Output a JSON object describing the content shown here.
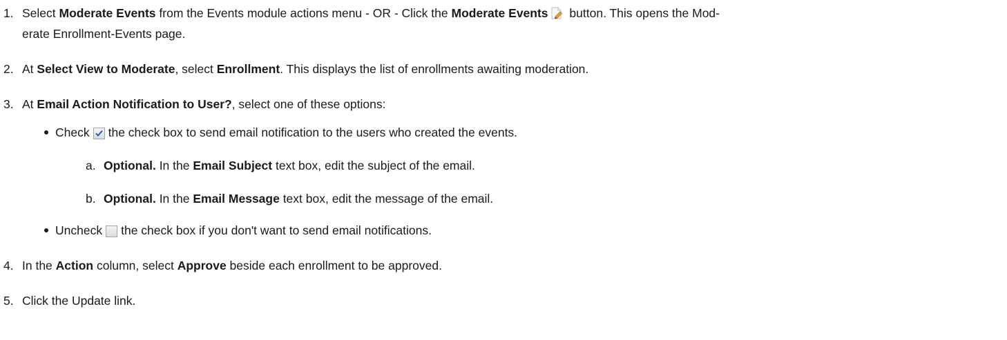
{
  "steps": [
    {
      "number": "1.",
      "part1": "Select ",
      "bold1": "Moderate Events",
      "part2": " from the Events module actions menu - OR - Click the ",
      "bold2": "Moderate Events",
      "part3": " button. This opens the Mod-",
      "line2": "erate Enrollment-Events page.",
      "icon": "pencil-edit-icon"
    },
    {
      "number": "2.",
      "part1": "At ",
      "bold1": "Select View to Moderate",
      "part2": ", select ",
      "bold2": "Enrollment",
      "part3": ". This displays the list of enrollments awaiting moderation."
    },
    {
      "number": "3.",
      "part1": "At ",
      "bold1": "Email Action Notification to User?",
      "part2": ", select one of these options:"
    },
    {
      "number": "4.",
      "part1": "In the ",
      "bold1": "Action",
      "part2": " column, select ",
      "bold2": "Approve",
      "part3": " beside each enrollment to be approved."
    },
    {
      "number": "5.",
      "part1": "Click the Update link."
    }
  ],
  "bullets": [
    {
      "part1": "Check",
      "icon": "checkbox-checked-icon",
      "part2": "the check box to send email notification to the users who created the events."
    },
    {
      "part1": "Uncheck",
      "icon": "checkbox-unchecked-icon",
      "part2": "the check box if you don't want to send email notifications."
    }
  ],
  "substeps": [
    {
      "letter": "a.",
      "bold1": "Optional.",
      "part1": " In the ",
      "bold2": "Email Subject",
      "part2": " text box, edit the subject of the email."
    },
    {
      "letter": "b.",
      "bold1": "Optional.",
      "part1": " In the ",
      "bold2": "Email Message",
      "part2": " text box, edit the message of the email."
    }
  ],
  "colors": {
    "text": "#1a1a1a",
    "checkbox_border": "#a0a8b0",
    "checkmark": "#2a5db0",
    "pencil": "#e08a20"
  }
}
